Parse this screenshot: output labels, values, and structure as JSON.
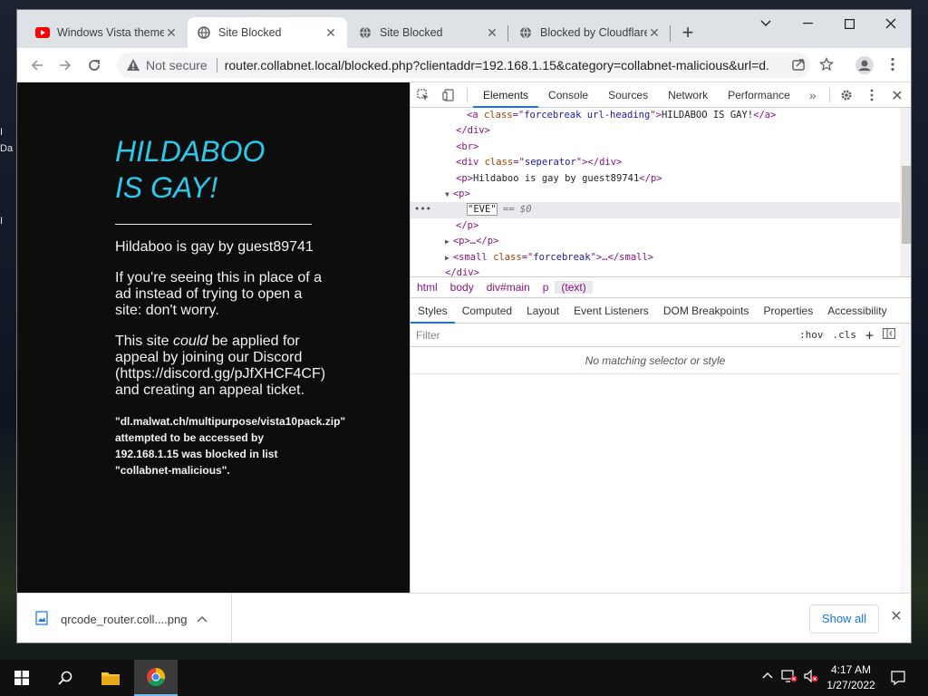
{
  "desktop": {
    "fragment_1": "I",
    "fragment_2": "Da",
    "fragment_3": "I"
  },
  "tabs": [
    {
      "title": "Windows Vista theme",
      "favicon": "youtube-icon"
    },
    {
      "title": "Site Blocked",
      "favicon": "globe-icon"
    },
    {
      "title": "Site Blocked",
      "favicon": "globe-icon"
    },
    {
      "title": "Blocked by Cloudflare",
      "favicon": "globe-icon"
    }
  ],
  "omnibox": {
    "security": "Not secure",
    "url": "router.collabnet.local/blocked.php?clientaddr=192.168.1.15&category=collabnet-malicious&url=d..."
  },
  "page": {
    "heading_line1": "HILDABOO",
    "heading_line2": "IS GAY!",
    "byline": "Hildaboo is gay by guest89741",
    "para1": "If you're seeing this in place of a ad instead of trying to open a site: don't worry.",
    "para2_pre": "This site ",
    "para2_em": "could",
    "para2_post": " be applied for appeal by joining our Discord (https://discord.gg/pJfXHCF4CF) and creating an appeal ticket.",
    "blocked_pre": "\"dl.malwat.ch/multipurpose/vista10pack.zip\" attempted to be accessed by ",
    "blocked_ip": "192.168.1.15",
    "blocked_post": " was blocked in list \"collabnet-malicious\"."
  },
  "devtools": {
    "tabs": [
      "Elements",
      "Console",
      "Sources",
      "Network",
      "Performance"
    ],
    "active_tab": "Elements",
    "dom": {
      "l1_attr": "class",
      "l1_val": "forcebreak url-heading",
      "l1_text": "HILDABOO IS GAY!",
      "l2": "</div>",
      "l3": "<br>",
      "l4_attr": "class",
      "l4_val": "seperator",
      "l5_text": "Hildaboo is gay by guest89741",
      "l6": "<p>",
      "l7_text": "\"EVE\"",
      "l7_suffix": " == $0",
      "l8": "</p>",
      "l9": "<p>…</p>",
      "l10_attr": "class",
      "l10_val": "forcebreak",
      "l11": "</div>"
    },
    "breadcrumbs": [
      "html",
      "body",
      "div#main",
      "p",
      "(text)"
    ],
    "subtabs": [
      "Styles",
      "Computed",
      "Layout",
      "Event Listeners",
      "DOM Breakpoints",
      "Properties",
      "Accessibility"
    ],
    "filter_placeholder": "Filter",
    "filter_hov": ":hov",
    "filter_cls": ".cls",
    "no_match": "No matching selector or style"
  },
  "download": {
    "filename": "qrcode_router.coll....png",
    "show_all": "Show all"
  },
  "taskbar": {
    "time": "4:17 AM",
    "date": "1/27/2022"
  }
}
